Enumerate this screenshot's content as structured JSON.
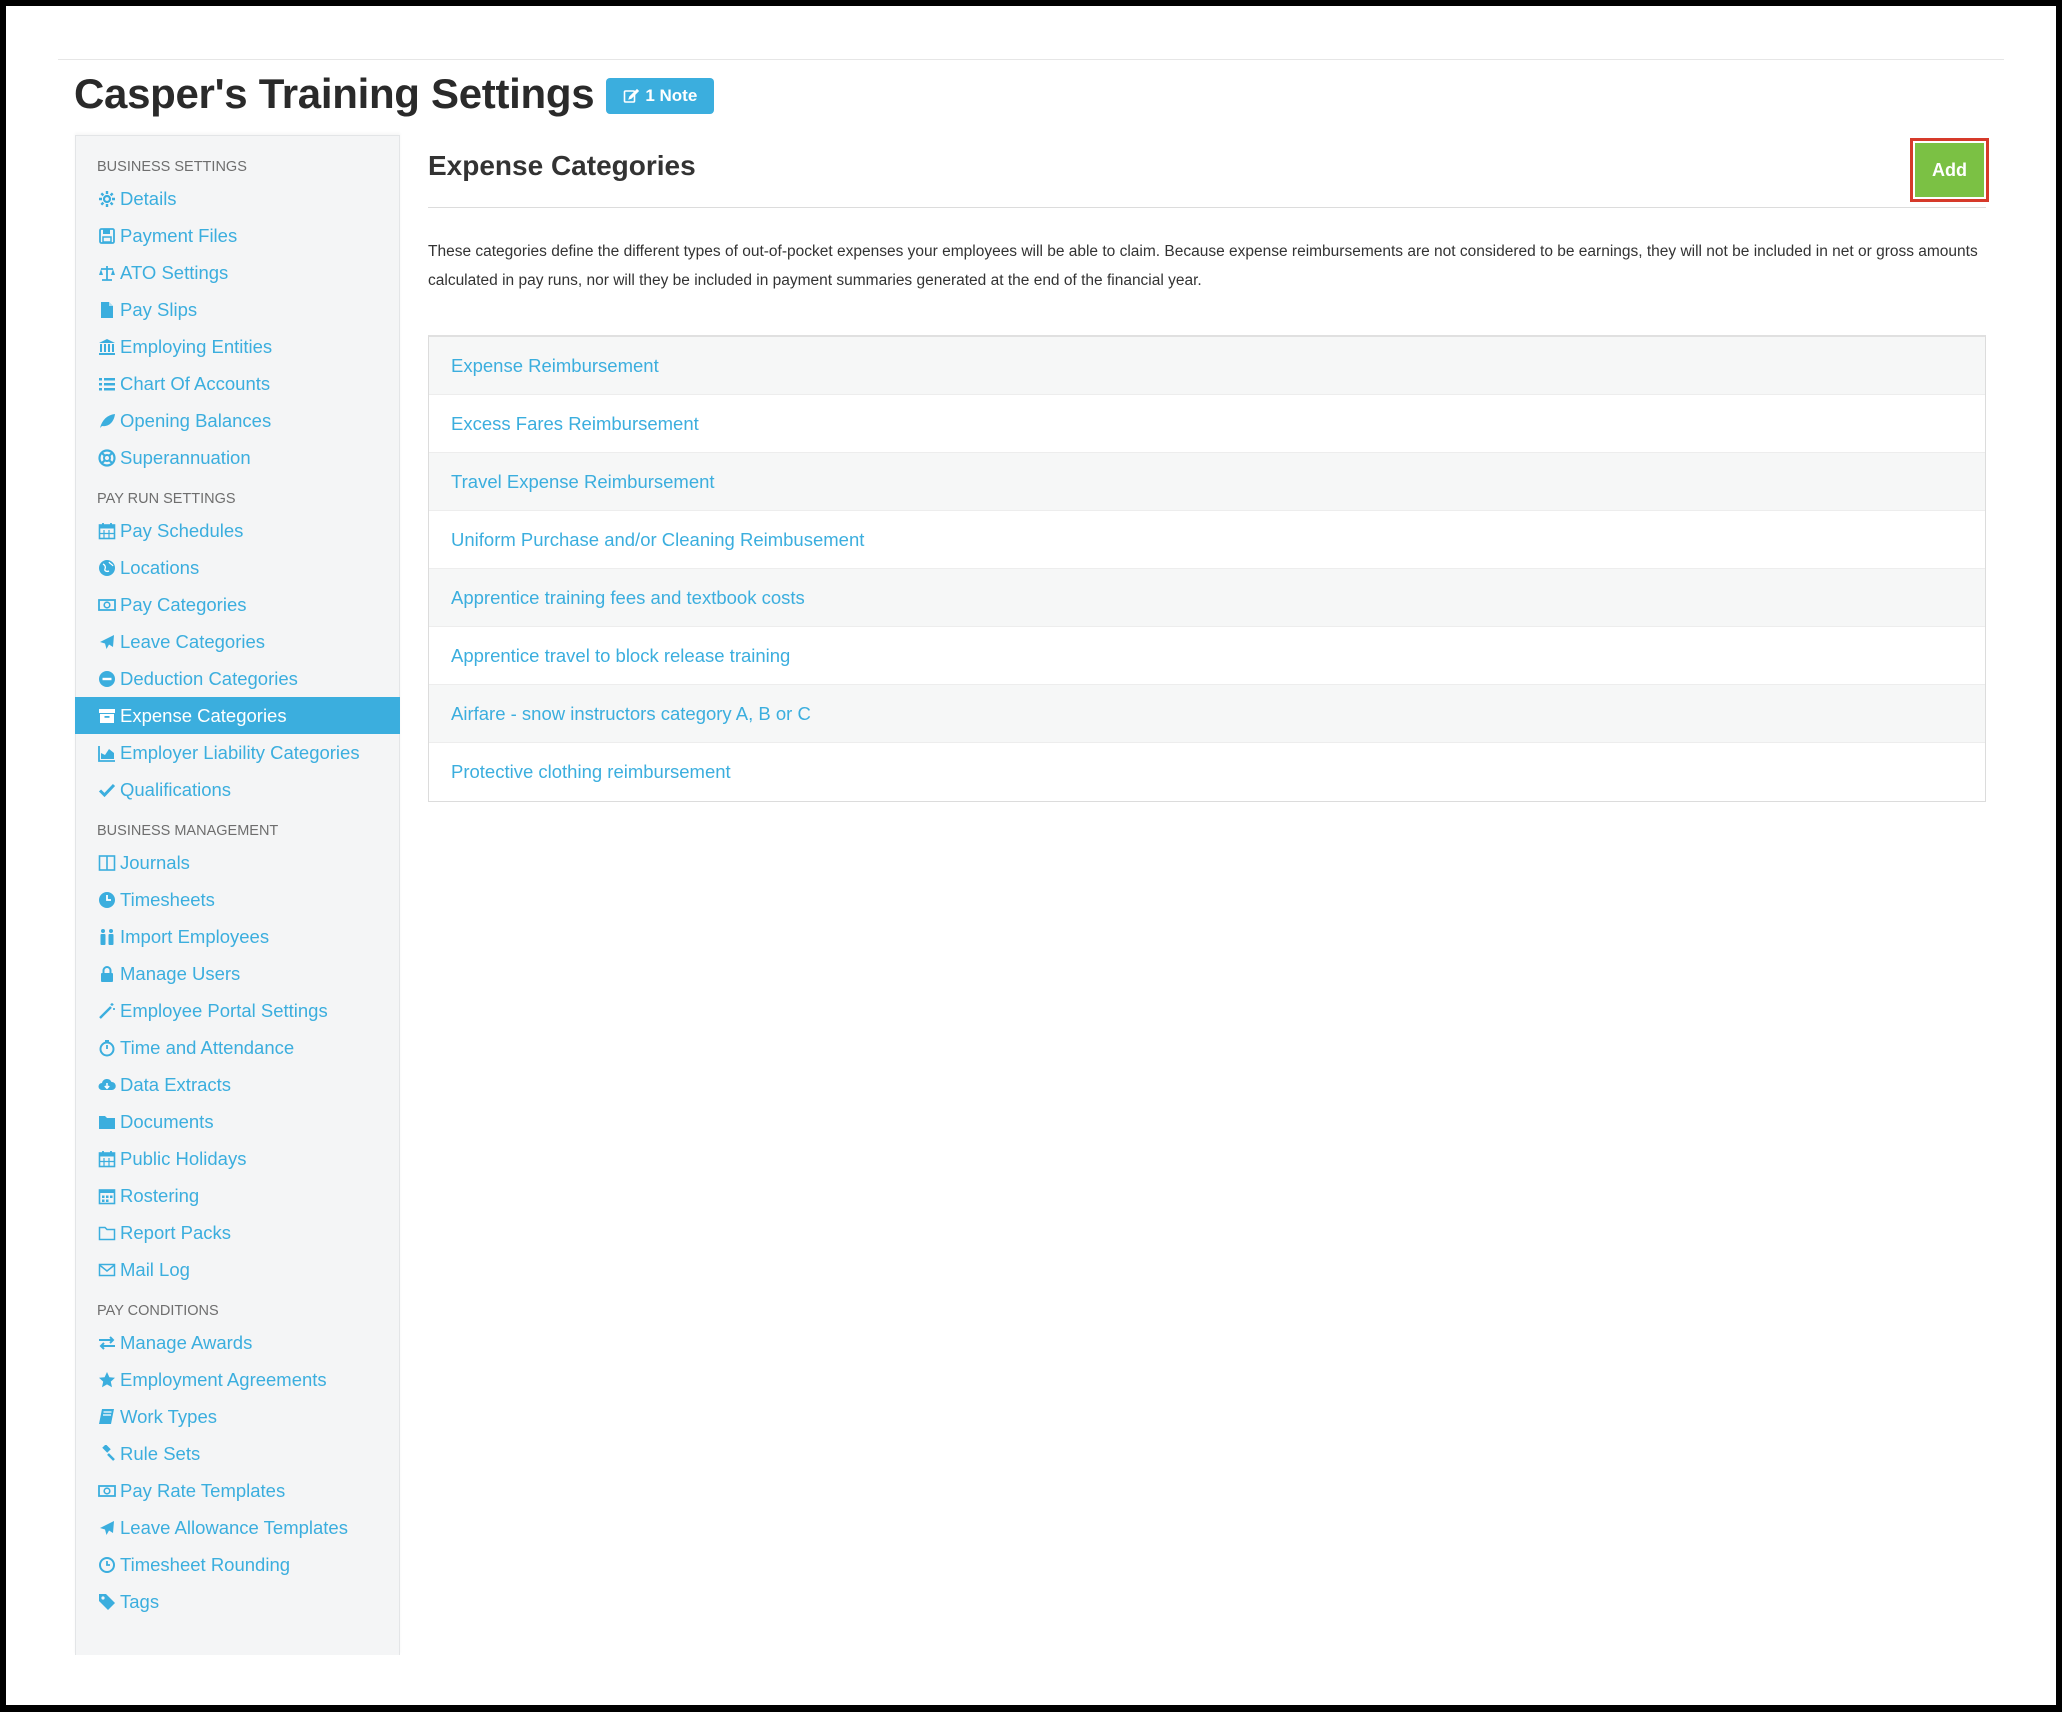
{
  "page": {
    "title": "Casper's Training Settings",
    "note_badge": "1 Note"
  },
  "colors": {
    "accent": "#3baede",
    "add_button": "#7bc144",
    "add_highlight": "#d63a2a"
  },
  "sidebar": {
    "groups": [
      {
        "heading": "BUSINESS SETTINGS",
        "items": [
          {
            "label": "Details",
            "icon": "gear-icon"
          },
          {
            "label": "Payment Files",
            "icon": "floppy-icon"
          },
          {
            "label": "ATO Settings",
            "icon": "scale-icon"
          },
          {
            "label": "Pay Slips",
            "icon": "file-icon"
          },
          {
            "label": "Employing Entities",
            "icon": "bank-icon"
          },
          {
            "label": "Chart Of Accounts",
            "icon": "list-icon"
          },
          {
            "label": "Opening Balances",
            "icon": "leaf-icon"
          },
          {
            "label": "Superannuation",
            "icon": "lifebuoy-icon"
          }
        ]
      },
      {
        "heading": "PAY RUN SETTINGS",
        "items": [
          {
            "label": "Pay Schedules",
            "icon": "calendar-icon"
          },
          {
            "label": "Locations",
            "icon": "globe-icon"
          },
          {
            "label": "Pay Categories",
            "icon": "money-icon"
          },
          {
            "label": "Leave Categories",
            "icon": "plane-icon"
          },
          {
            "label": "Deduction Categories",
            "icon": "minus-circle-icon"
          },
          {
            "label": "Expense Categories",
            "icon": "archive-icon",
            "active": true
          },
          {
            "label": "Employer Liability Categories",
            "icon": "area-chart-icon"
          },
          {
            "label": "Qualifications",
            "icon": "check-icon"
          }
        ]
      },
      {
        "heading": "BUSINESS MANAGEMENT",
        "items": [
          {
            "label": "Journals",
            "icon": "columns-icon"
          },
          {
            "label": "Timesheets",
            "icon": "clock-icon"
          },
          {
            "label": "Import Employees",
            "icon": "people-icon"
          },
          {
            "label": "Manage Users",
            "icon": "lock-icon"
          },
          {
            "label": "Employee Portal Settings",
            "icon": "wand-icon"
          },
          {
            "label": "Time and Attendance",
            "icon": "stopwatch-icon"
          },
          {
            "label": "Data Extracts",
            "icon": "cloud-download-icon"
          },
          {
            "label": "Documents",
            "icon": "folder-icon"
          },
          {
            "label": "Public Holidays",
            "icon": "calendar-icon"
          },
          {
            "label": "Rostering",
            "icon": "calendar-grid-icon"
          },
          {
            "label": "Report Packs",
            "icon": "folder-open-icon"
          },
          {
            "label": "Mail Log",
            "icon": "envelope-icon"
          }
        ]
      },
      {
        "heading": "PAY CONDITIONS",
        "items": [
          {
            "label": "Manage Awards",
            "icon": "exchange-icon"
          },
          {
            "label": "Employment Agreements",
            "icon": "star-icon"
          },
          {
            "label": "Work Types",
            "icon": "book-icon"
          },
          {
            "label": "Rule Sets",
            "icon": "gavel-icon"
          },
          {
            "label": "Pay Rate Templates",
            "icon": "money-icon"
          },
          {
            "label": "Leave Allowance Templates",
            "icon": "plane-icon"
          },
          {
            "label": "Timesheet Rounding",
            "icon": "clock-outline-icon"
          },
          {
            "label": "Tags",
            "icon": "tag-icon"
          }
        ]
      }
    ]
  },
  "main": {
    "title": "Expense Categories",
    "add_label": "Add",
    "description": "These categories define the different types of out-of-pocket expenses your employees will be able to claim. Because expense reimbursements are not considered to be earnings, they will not be included in net or gross amounts calculated in pay runs, nor will they be included in payment summaries generated at the end of the financial year.",
    "categories": [
      "Expense Reimbursement",
      "Excess Fares Reimbursement",
      "Travel Expense Reimbursement",
      "Uniform Purchase and/or Cleaning Reimbusement",
      "Apprentice training fees and textbook costs",
      "Apprentice travel to block release training",
      "Airfare - snow instructors category A, B or C",
      "Protective clothing reimbursement"
    ]
  }
}
